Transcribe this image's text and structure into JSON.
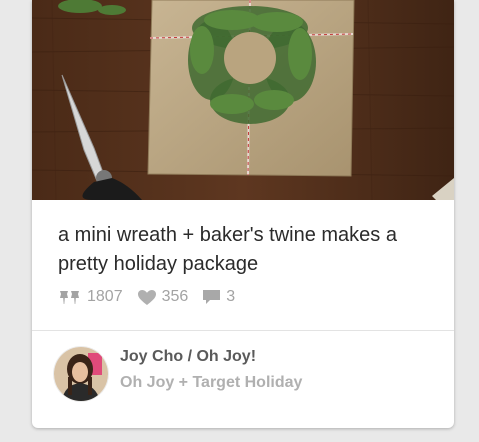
{
  "pin": {
    "description": "a mini wreath + baker's twine makes a pretty holiday package",
    "repins": "1807",
    "likes": "356",
    "comments": "3"
  },
  "attribution": {
    "pinner": "Joy Cho / Oh Joy!",
    "board": "Oh Joy + Target Holiday"
  },
  "icons": {
    "repin": "pin-icon",
    "like": "heart-icon",
    "comment": "comment-icon"
  },
  "colors": {
    "background": "#e9e9e9",
    "card": "#ffffff",
    "stat_text": "#a3a3a3",
    "pinner_text": "#5a5a5a",
    "board_text": "#b0b0b0"
  }
}
